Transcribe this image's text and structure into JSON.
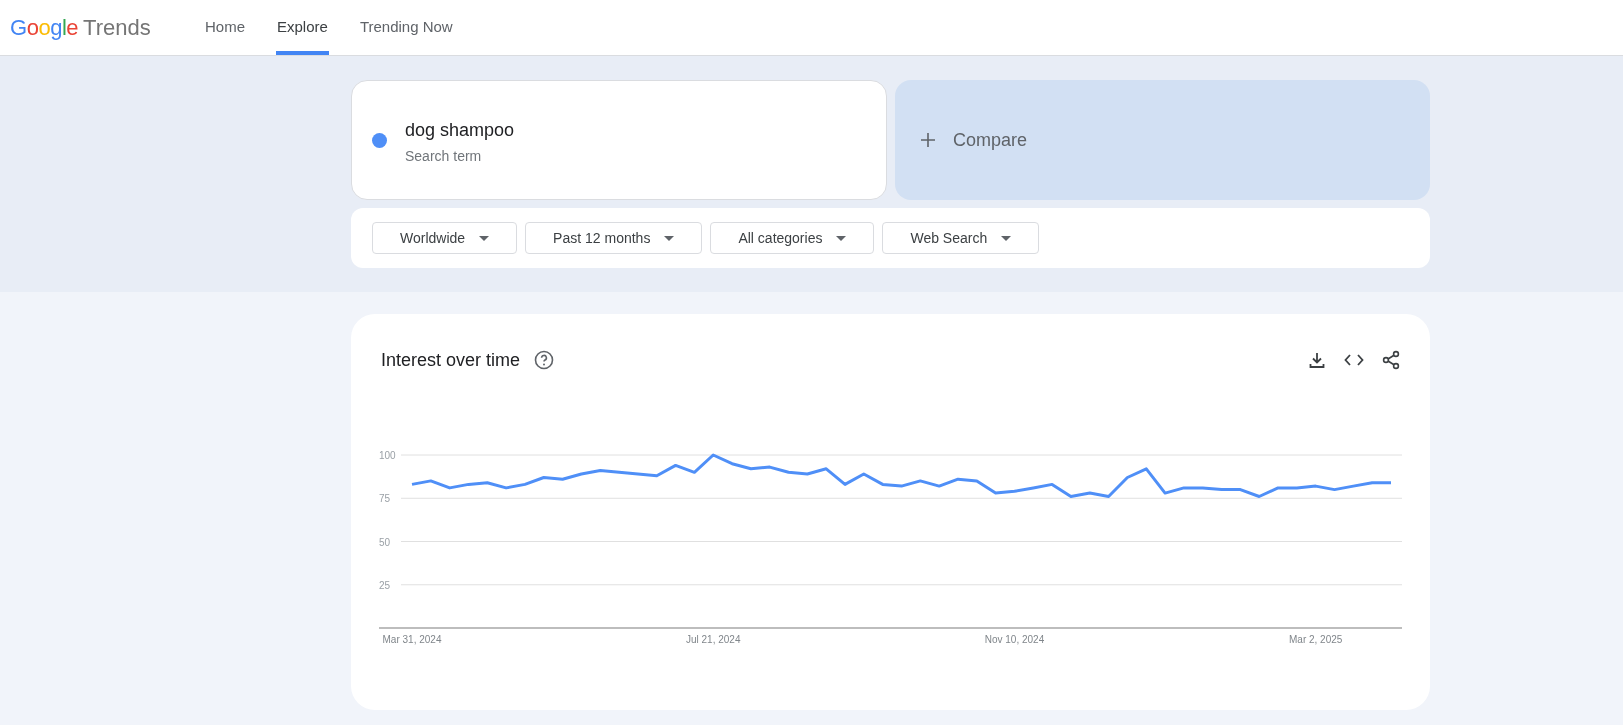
{
  "logo": {
    "brand": "Google",
    "product": "Trends"
  },
  "nav": [
    {
      "label": "Home",
      "selected": false
    },
    {
      "label": "Explore",
      "selected": true
    },
    {
      "label": "Trending Now",
      "selected": false
    }
  ],
  "search_terms": [
    {
      "term": "dog shampoo",
      "subtitle": "Search term",
      "color": "#4f8ff7"
    }
  ],
  "compare": {
    "label": "Compare"
  },
  "filters": [
    {
      "label": "Worldwide"
    },
    {
      "label": "Past 12 months"
    },
    {
      "label": "All categories"
    },
    {
      "label": "Web Search"
    }
  ],
  "interest_over_time": {
    "title": "Interest over time",
    "chart_data": {
      "type": "line",
      "categories": [
        "Mar 31, 2024",
        null,
        null,
        null,
        null,
        null,
        null,
        null,
        null,
        null,
        null,
        null,
        null,
        null,
        null,
        null,
        "Jul 21, 2024",
        null,
        null,
        null,
        null,
        null,
        null,
        null,
        null,
        null,
        null,
        null,
        null,
        null,
        null,
        null,
        "Nov 10, 2024",
        null,
        null,
        null,
        null,
        null,
        null,
        null,
        null,
        null,
        null,
        null,
        null,
        null,
        null,
        null,
        "Mar 2, 2025",
        null,
        null,
        null,
        null
      ],
      "series": [
        {
          "color": "#4f8ff7",
          "values": [
            83,
            85,
            81,
            83,
            84,
            81,
            83,
            87,
            86,
            89,
            91,
            90,
            89,
            88,
            94,
            90,
            100,
            95,
            92,
            93,
            90,
            89,
            92,
            83,
            89,
            83,
            82,
            85,
            82,
            86,
            85,
            78,
            79,
            81,
            83,
            76,
            78,
            76,
            87,
            92,
            78,
            81,
            81,
            80,
            80,
            76,
            81,
            81,
            82,
            80,
            82,
            84,
            84
          ]
        }
      ],
      "ylim": [
        0,
        100
      ],
      "grid": true,
      "yticks": [
        25,
        50,
        75,
        100
      ]
    }
  }
}
